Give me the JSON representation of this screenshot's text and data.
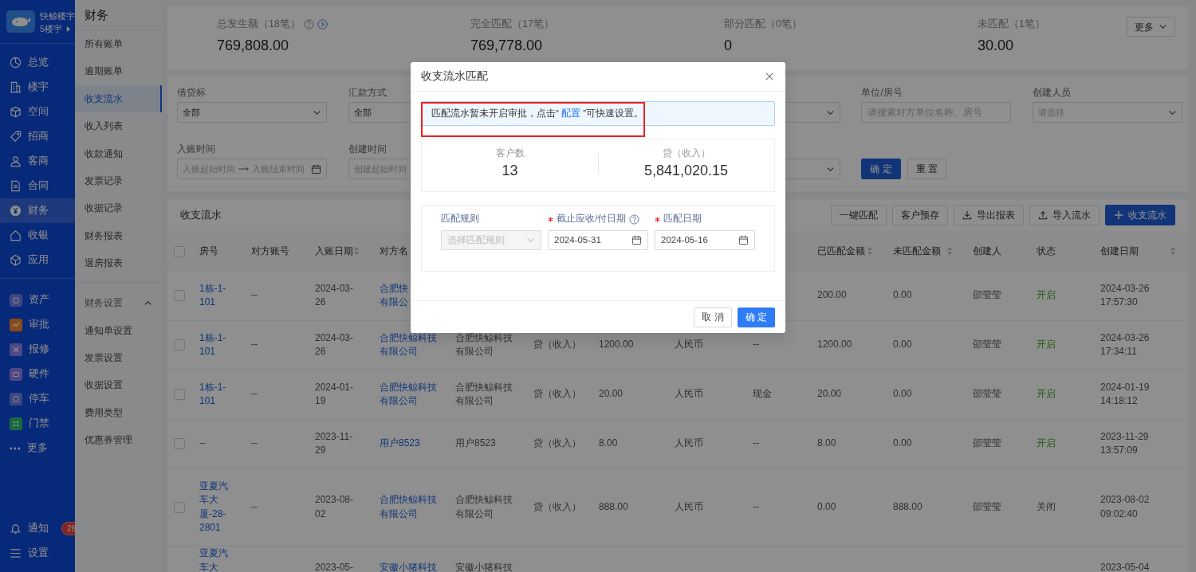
{
  "sidebar": {
    "brand": {
      "name": "快鲸楼宇",
      "project": "5楼宇"
    },
    "nav": [
      {
        "label": "总览",
        "selected": false
      },
      {
        "label": "楼宇",
        "selected": false
      },
      {
        "label": "空间",
        "selected": false
      },
      {
        "label": "招商",
        "selected": false
      },
      {
        "label": "客商",
        "selected": false
      },
      {
        "label": "合同",
        "selected": false
      },
      {
        "label": "财务",
        "selected": true
      },
      {
        "label": "收银",
        "selected": false
      },
      {
        "label": "应用",
        "selected": false
      }
    ],
    "apps": [
      {
        "label": "资产",
        "color": "#3e4782"
      },
      {
        "label": "审批",
        "color": "#89491a"
      },
      {
        "label": "报修",
        "color": "#4f4786"
      },
      {
        "label": "硬件",
        "color": "#4f4786"
      },
      {
        "label": "停车",
        "color": "#3e4782"
      },
      {
        "label": "门禁",
        "color": "#1a6b3f"
      }
    ],
    "more": "更多",
    "notifications": {
      "label": "通知",
      "count": "26"
    },
    "settings": "设置"
  },
  "subnav": {
    "title": "财务",
    "items": [
      {
        "label": "所有账单",
        "selected": false
      },
      {
        "label": "逾期账单",
        "selected": false
      },
      {
        "label": "收支流水",
        "selected": true
      },
      {
        "label": "收入列表",
        "selected": false
      },
      {
        "label": "收款通知",
        "selected": false
      },
      {
        "label": "发票记录",
        "selected": false
      },
      {
        "label": "收据记录",
        "selected": false
      },
      {
        "label": "财务报表",
        "selected": false
      },
      {
        "label": "退房报表",
        "selected": false
      }
    ],
    "group": {
      "label": "财务设置",
      "expanded": true,
      "items": [
        "通知单设置",
        "发票设置",
        "收据设置",
        "费用类型",
        "优惠券管理"
      ]
    }
  },
  "stats": [
    {
      "label": "总发生额（18笔）",
      "value": "769,808.00",
      "help": true,
      "link": true
    },
    {
      "label": "完全匹配（17笔）",
      "value": "769,778.00",
      "help": false,
      "link": false
    },
    {
      "label": "部分匹配（0笔）",
      "value": "0",
      "help": false,
      "link": false
    },
    {
      "label": "未匹配（1笔）",
      "value": "30.00",
      "help": false,
      "link": false
    }
  ],
  "more_button": "更多",
  "filters": [
    {
      "kind": "select",
      "label": "借贷标",
      "value": "全部"
    },
    {
      "kind": "box",
      "label": "汇款方式",
      "value": "全部"
    },
    {
      "kind": "covered"
    },
    {
      "kind": "select"
    },
    {
      "kind": "input",
      "label": "单位/房号",
      "placeholder": "请搜索对方单位名称、房号"
    },
    {
      "kind": "select",
      "label": "创建人员",
      "placeholder": "请选择"
    },
    {
      "kind": "range",
      "label": "入账时间",
      "placeholder": "入账起始时间",
      "placeholder_end": "入账结束时间"
    },
    {
      "kind": "range",
      "label": "创建时间",
      "placeholder": "创建起始时间"
    },
    {
      "kind": "covered"
    },
    {
      "kind": "select"
    },
    {
      "kind": "actions",
      "buttons": [
        {
          "label": "确 定",
          "primary": true
        },
        {
          "label": "重 置",
          "primary": false
        }
      ]
    }
  ],
  "table": {
    "title": "收支流水",
    "toolbar": [
      {
        "label": "一键匹配",
        "kind": "plain"
      },
      {
        "label": "客户预存",
        "kind": "plain"
      },
      {
        "label": "导出报表",
        "kind": "export"
      },
      {
        "label": "导入流水",
        "kind": "import"
      },
      {
        "label": "收支流水",
        "kind": "add"
      }
    ],
    "header_checked": false,
    "columns": [
      {
        "label": "房号",
        "sortable": false
      },
      {
        "label": "对方账号",
        "sortable": false
      },
      {
        "label": "入账日期",
        "sortable": true
      },
      {
        "label": "对方名"
      },
      {
        "label": "已匹配金额",
        "sortable": true
      },
      {
        "label": "未匹配金额",
        "sortable": true
      },
      {
        "label": "创建人",
        "sortable": false
      },
      {
        "label": "状态",
        "sortable": false
      },
      {
        "label": "创建日期",
        "sortable": true
      }
    ],
    "rows": [
      {
        "checked": false,
        "room": "1栋-1-101",
        "room_link": true,
        "account": "--",
        "date": "2024-03-26",
        "party": [
          "合肥快",
          "有限公"
        ],
        "matched": "200.00",
        "unmatched": "0.00",
        "creator": "邵莹莹",
        "status": {
          "label": "开启",
          "on": true
        },
        "created": "2024-03-26 17:57:30"
      },
      {
        "checked": false,
        "room": "1栋-1-101",
        "room_link": true,
        "account": "--",
        "date": "2024-03-26",
        "party": "合肥快鲸科技有限公司",
        "column_6": "合肥快鲸科技有限公司",
        "column_7": "贷（收入）",
        "column_8": "1200.00",
        "column_9": "人民币",
        "column_10": "--",
        "matched": "1200.00",
        "unmatched": "0.00",
        "creator": "邵莹莹",
        "status": {
          "label": "开启",
          "on": true
        },
        "created": "2024-03-26 17:34:11"
      },
      {
        "checked": false,
        "room": "1栋-1-101",
        "room_link": true,
        "account": "--",
        "date": "2024-01-19",
        "party": "合肥快鲸科技有限公司",
        "column_6": "合肥快鲸科技有限公司",
        "column_7": "贷（收入）",
        "column_8": "20.00",
        "column_9": "人民币",
        "column_10": "现金",
        "matched": "20.00",
        "unmatched": "0.00",
        "creator": "邵莹莹",
        "status": {
          "label": "开启",
          "on": true
        },
        "created": "2024-01-19 14:18:12"
      },
      {
        "checked": false,
        "room": "--",
        "room_link": false,
        "account": "--",
        "date": "2023-11-29",
        "party": "用户8523",
        "column_6": "用户8523",
        "column_7": "贷（收入）",
        "column_8": "8.00",
        "column_9": "人民币",
        "column_10": "--",
        "matched": "8.00",
        "unmatched": "0.00",
        "creator": "邵莹莹",
        "status": {
          "label": "开启",
          "on": true
        },
        "created": "2023-11-29 13:57:09"
      },
      {
        "checked": false,
        "room": "亚夏汽车大厦-28-2801",
        "room_link": true,
        "account": "--",
        "date": "2023-08-02",
        "party": "合肥快鲸科技有限公司",
        "column_6": "合肥快鲸科技有限公司",
        "column_7": "贷（收入）",
        "column_8": "888.00",
        "column_9": "人民币",
        "column_10": "--",
        "matched": "0.00",
        "unmatched": "888.00",
        "creator": "邵莹莹",
        "status": {
          "label": "关闭",
          "on": false
        },
        "created": "2023-08-02 09:02:40"
      },
      {
        "room": "亚夏汽车大",
        "room_link": true,
        "date": "2023-05-",
        "party": "安徽小猪科技",
        "column_6": "安徽小猪科技",
        "created": "2023-05-04"
      }
    ]
  },
  "dialog": {
    "title": "收支流水匹配",
    "notice": {
      "before": "匹配流水暂未开启审批，点击“ ",
      "link": "配置",
      "after": " ”可快速设置。",
      "highlighted": true
    },
    "summary": [
      {
        "label": "客户数",
        "value": "13"
      },
      {
        "label": "贷（收入）",
        "value": "5,841,020.15"
      }
    ],
    "fields": [
      {
        "kind": "select",
        "label": "匹配规则",
        "required": false,
        "help": false,
        "placeholder": "选择匹配规则",
        "disabled": true
      },
      {
        "kind": "date",
        "label": "截止应收/付日期",
        "required": true,
        "help": true,
        "value": "2024-05-31",
        "disabled": false
      },
      {
        "kind": "date",
        "label": "匹配日期",
        "required": true,
        "help": false,
        "value": "2024-05-16",
        "disabled": false
      }
    ],
    "buttons": [
      {
        "label": "取 消",
        "primary": false
      },
      {
        "label": "确 定",
        "primary": true
      }
    ]
  }
}
